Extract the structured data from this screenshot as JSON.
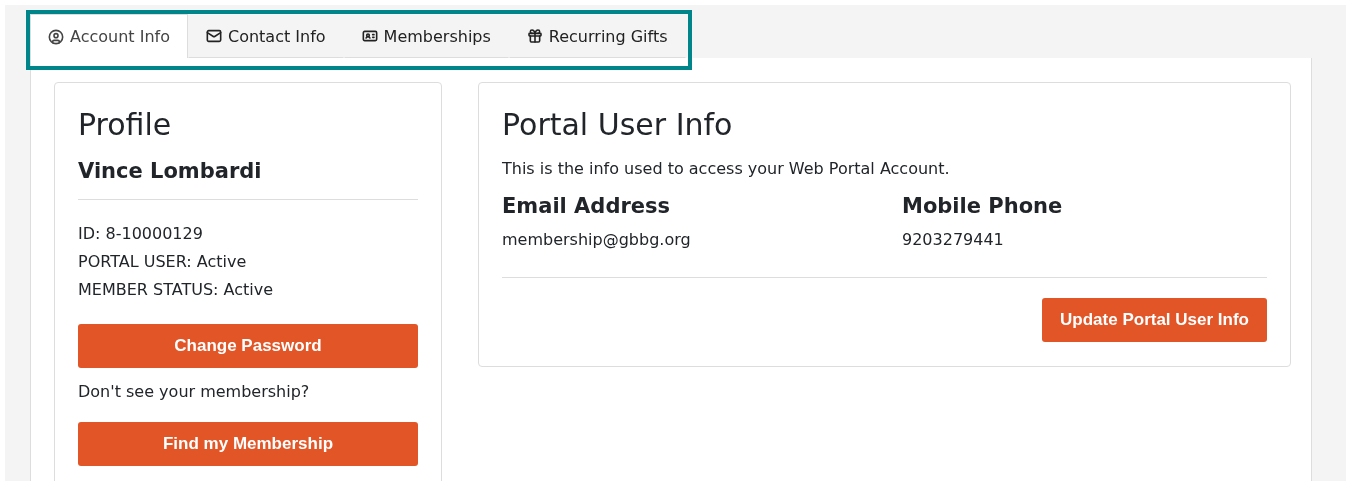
{
  "tabs": [
    {
      "label": "Account Info",
      "selected": true
    },
    {
      "label": "Contact Info",
      "selected": false
    },
    {
      "label": "Memberships",
      "selected": false
    },
    {
      "label": "Recurring Gifts",
      "selected": false
    }
  ],
  "profile": {
    "title": "Profile",
    "name": "Vince Lombardi",
    "details": [
      "ID: 8-10000129",
      "PORTAL USER: Active",
      "MEMBER STATUS: Active"
    ],
    "change_password_button": "Change Password",
    "prompt": "Don't see your membership?",
    "find_button": "Find my Membership"
  },
  "portal_user_info": {
    "title": "Portal User Info",
    "description": "This is the info used to access your Web Portal Account.",
    "fields": [
      {
        "label": "Email Address",
        "value": "membership@gbbg.org"
      },
      {
        "label": "Mobile Phone",
        "value": "9203279441"
      }
    ],
    "update_button": "Update Portal User Info"
  }
}
